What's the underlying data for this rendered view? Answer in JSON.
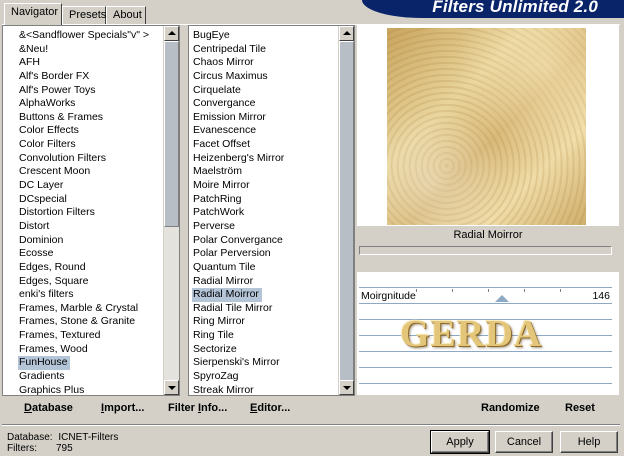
{
  "tabs": [
    {
      "label": "Navigator",
      "active": true
    },
    {
      "label": "Presets",
      "active": false
    },
    {
      "label": "About",
      "active": false
    }
  ],
  "header": {
    "title": "Filters Unlimited 2.0"
  },
  "categories": {
    "items": [
      "&<Sandflower Specials\"v\" >",
      "&Neu!",
      "AFH",
      "Alf's Border FX",
      "Alf's Power Toys",
      "AlphaWorks",
      "Buttons & Frames",
      "Color Effects",
      "Color Filters",
      "Convolution Filters",
      "Crescent Moon",
      "DC Layer",
      "DCspecial",
      "Distortion Filters",
      "Distort",
      "Dominion",
      "Ecosse",
      "Edges, Round",
      "Edges, Square",
      "enki's filters",
      "Frames, Marble & Crystal",
      "Frames, Stone & Granite",
      "Frames, Textured",
      "Frames, Wood",
      "FunHouse",
      "Gradients",
      "Graphics Plus"
    ],
    "selected": "FunHouse"
  },
  "filters": {
    "items": [
      "BugEye",
      "Centripedal Tile",
      "Chaos Mirror",
      "Circus Maximus",
      "Cirquelate",
      "Convergance",
      "Emission Mirror",
      "Evanescence",
      "Facet Offset",
      "Heizenberg's Mirror",
      "Maelström",
      "Moire Mirror",
      "PatchRing",
      "PatchWork",
      "Perverse",
      "Polar Convergance",
      "Polar Perversion",
      "Quantum Tile",
      "Radial Mirror",
      "Radial Moirror",
      "Radial Tile Mirror",
      "Ring Mirror",
      "Ring Tile",
      "Sectorize",
      "Sierpenski's Mirror",
      "SpyroZag",
      "Streak Mirror"
    ],
    "selected": "Radial Moirror"
  },
  "preview": {
    "filter_name": "Radial Moirror",
    "watermark": "GERDA"
  },
  "slider": {
    "label": "Moirgnitude",
    "value": "146",
    "fraction": 0.57
  },
  "toolbar": {
    "database": {
      "pre": "",
      "u": "D",
      "post": "atabase"
    },
    "import": {
      "pre": "",
      "u": "I",
      "post": "mport..."
    },
    "filter_info": {
      "pre": "Filter ",
      "u": "I",
      "post": "nfo..."
    },
    "editor": {
      "pre": "",
      "u": "E",
      "post": "ditor..."
    },
    "randomize": "Randomize",
    "reset": "Reset"
  },
  "status": {
    "database_label": "Database:",
    "database_value": "ICNET-Filters",
    "filters_label": "Filters:",
    "filters_value": "795"
  },
  "buttons": {
    "apply": "Apply",
    "cancel": "Cancel",
    "help": "Help"
  },
  "colors": {
    "title_bar": "#0a246a",
    "selection": "#b5c5d8",
    "slider_accent": "#8da9c4"
  }
}
